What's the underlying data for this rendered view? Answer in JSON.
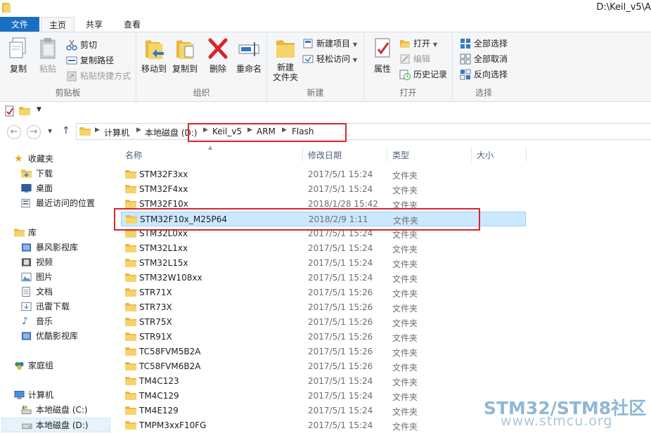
{
  "window": {
    "title": "D:\\Keil_v5\\A"
  },
  "tabs": {
    "file": "文件",
    "home": "主页",
    "share": "共享",
    "view": "查看"
  },
  "ribbon": {
    "clipboard": {
      "label": "剪贴板",
      "copy": "复制",
      "paste": "粘贴",
      "cut": "剪切",
      "copy_path": "复制路径",
      "paste_shortcut": "粘贴快捷方式"
    },
    "organize": {
      "label": "组织",
      "move_to": "移动到",
      "copy_to": "复制到",
      "delete": "删除",
      "rename": "重命名"
    },
    "new": {
      "label": "新建",
      "new_folder_line1": "新建",
      "new_folder_line2": "文件夹",
      "new_item": "新建项目",
      "easy_access": "轻松访问"
    },
    "open": {
      "label": "打开",
      "properties": "属性",
      "open": "打开",
      "edit": "编辑",
      "history": "历史记录"
    },
    "select": {
      "label": "选择",
      "select_all": "全部选择",
      "select_none": "全部取消",
      "invert": "反向选择"
    }
  },
  "address": {
    "crumbs": [
      "计算机",
      "本地磁盘 (D:)",
      "Keil_v5",
      "ARM",
      "Flash"
    ]
  },
  "nav": {
    "favorites": "收藏夹",
    "downloads": "下载",
    "desktop": "桌面",
    "recent": "最近访问的位置",
    "libraries": "库",
    "baofeng": "暴风影视库",
    "videos": "视频",
    "pictures": "图片",
    "documents": "文档",
    "xunlei": "迅雷下载",
    "music": "音乐",
    "youku": "优酷影视库",
    "homegroup": "家庭组",
    "computer": "计算机",
    "drive_c": "本地磁盘 (C:)",
    "drive_d": "本地磁盘 (D:)"
  },
  "columns": {
    "name": "名称",
    "modified": "修改日期",
    "type": "类型",
    "size": "大小"
  },
  "files": [
    {
      "name": "STM32F3xx",
      "date": "2017/5/1 15:24",
      "type": "文件夹"
    },
    {
      "name": "STM32F4xx",
      "date": "2017/5/1 15:24",
      "type": "文件夹"
    },
    {
      "name": "STM32F10x",
      "date": "2018/1/28 15:42",
      "type": "文件夹"
    },
    {
      "name": "STM32F10x_M25P64",
      "date": "2018/2/9 1:11",
      "type": "文件夹"
    },
    {
      "name": "STM32L0xx",
      "date": "2017/5/1 15:24",
      "type": "文件夹"
    },
    {
      "name": "STM32L1xx",
      "date": "2017/5/1 15:24",
      "type": "文件夹"
    },
    {
      "name": "STM32L15x",
      "date": "2017/5/1 15:24",
      "type": "文件夹"
    },
    {
      "name": "STM32W108xx",
      "date": "2017/5/1 15:24",
      "type": "文件夹"
    },
    {
      "name": "STR71X",
      "date": "2017/5/1 15:26",
      "type": "文件夹"
    },
    {
      "name": "STR73X",
      "date": "2017/5/1 15:26",
      "type": "文件夹"
    },
    {
      "name": "STR75X",
      "date": "2017/5/1 15:26",
      "type": "文件夹"
    },
    {
      "name": "STR91X",
      "date": "2017/5/1 15:26",
      "type": "文件夹"
    },
    {
      "name": "TC58FVM5B2A",
      "date": "2017/5/1 15:26",
      "type": "文件夹"
    },
    {
      "name": "TC58FVM6B2A",
      "date": "2017/5/1 15:26",
      "type": "文件夹"
    },
    {
      "name": "TM4C123",
      "date": "2017/5/1 15:24",
      "type": "文件夹"
    },
    {
      "name": "TM4C129",
      "date": "2017/5/1 15:24",
      "type": "文件夹"
    },
    {
      "name": "TM4E129",
      "date": "2017/5/1 15:24",
      "type": "文件夹"
    },
    {
      "name": "TMPM3xxF10FG",
      "date": "2017/5/1 15:24",
      "type": "文件夹"
    }
  ],
  "watermark": {
    "line1": "STM32/STM8社区",
    "line2": "www.stmcu.org"
  },
  "colors": {
    "accent": "#1a6fc4",
    "selection": "#cce8ff",
    "highlight_box": "#d9262c",
    "folder": "#f3c44e"
  }
}
